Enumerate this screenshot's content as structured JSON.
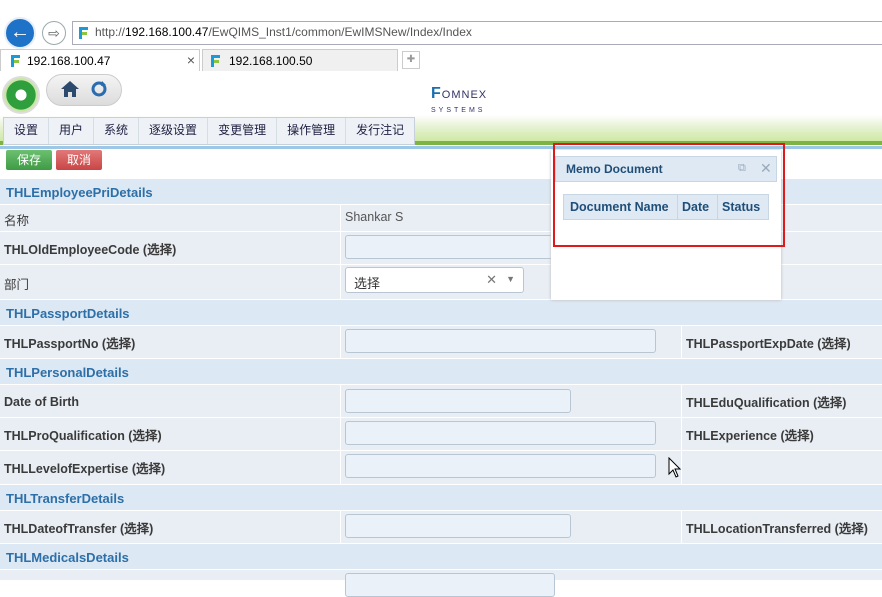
{
  "browser": {
    "url_prefix": "http://",
    "url_host": "192.168.100.47",
    "url_path": "/EwQIMS_Inst1/common/EwIMSNew/Index/Index",
    "tabs": [
      {
        "label": "192.168.100.47",
        "close": "×"
      },
      {
        "label": "192.168.100.50"
      }
    ]
  },
  "app": {
    "logo_text": "OMNEX",
    "logo_sub": "SYSTEMS",
    "menu": [
      "设置",
      "用户",
      "系统",
      "逐级设置",
      "变更管理",
      "操作管理",
      "发行注记"
    ]
  },
  "toolbar": {
    "save_label": "保存",
    "cancel_label": "取消"
  },
  "form": {
    "sections": {
      "employee": "THLEmployeePriDetails",
      "passport": "THLPassportDetails",
      "personal": "THLPersonalDetails",
      "transfer": "THLTransferDetails",
      "medicals": "THLMedicalsDetails"
    },
    "fields": {
      "name_label": "名称",
      "name_value": "Shankar S",
      "old_code_label": "THLOldEmployeeCode (选择)",
      "dept_label": "部门",
      "dept_value": "选择",
      "passport_no_label": "THLPassportNo (选择)",
      "passport_exp_label": "THLPassportExpDate (选择)",
      "dob_label": "Date of Birth",
      "edu_label": "THLEduQualification (选择)",
      "proq_label": "THLProQualification (选择)",
      "exp_label": "THLExperience (选择)",
      "level_label": "THLLevelofExpertise (选择)",
      "transfer_date_label": "THLDateofTransfer (选择)",
      "location_label": "THLLocationTransferred (选择)"
    }
  },
  "memo": {
    "title": "Memo Document",
    "columns": [
      "Document Name",
      "Date",
      "Status"
    ]
  },
  "colors": {
    "highlight": "#e0191b",
    "section_text": "#2d6fa8",
    "menu_accent": "#7cb342"
  }
}
